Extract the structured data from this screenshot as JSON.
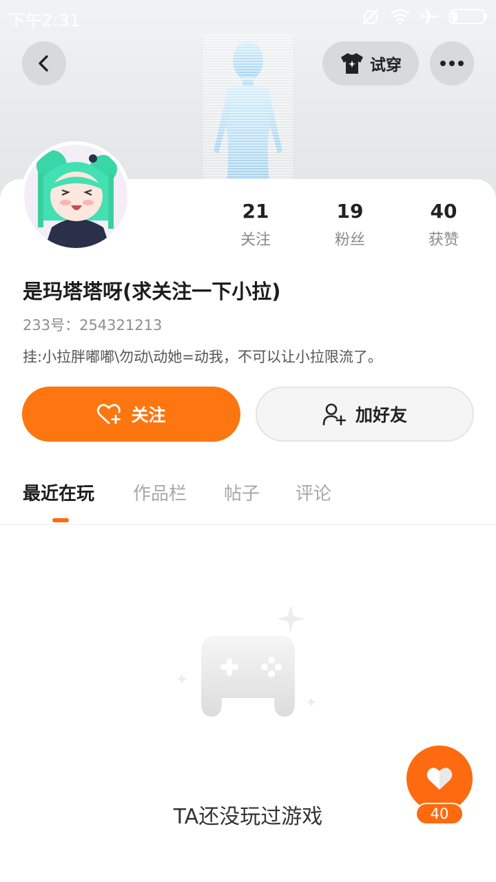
{
  "status_bar": {
    "time": "下午2:31",
    "icons": [
      "alarm-off-icon",
      "wifi-icon",
      "airplane-icon",
      "battery-icon"
    ]
  },
  "header": {
    "back_icon": "chevron-left-icon",
    "tryon_label": "试穿",
    "tryon_icon": "tshirt-icon",
    "more_icon": "more-horizontal-icon"
  },
  "profile": {
    "name": "是玛塔塔呀(求关注一下小拉)",
    "uid": "233号：254321213",
    "bio": "挂:小拉胖嘟嘟\\勿动\\动她=动我，不可以让小拉限流了。",
    "stats": [
      {
        "value": "21",
        "label": "关注"
      },
      {
        "value": "19",
        "label": "粉丝"
      },
      {
        "value": "40",
        "label": "获赞"
      }
    ]
  },
  "actions": {
    "follow_label": "关注",
    "add_friend_label": "加好友"
  },
  "tabs": [
    {
      "label": "最近在玩",
      "active": true
    },
    {
      "label": "作品栏",
      "active": false
    },
    {
      "label": "帖子",
      "active": false
    },
    {
      "label": "评论",
      "active": false
    }
  ],
  "empty_state": {
    "text": "TA还没玩过游戏"
  },
  "like_fab": {
    "count": "40"
  },
  "colors": {
    "accent": "#fd760f",
    "tab_active_indicator": "#fd6a10"
  }
}
